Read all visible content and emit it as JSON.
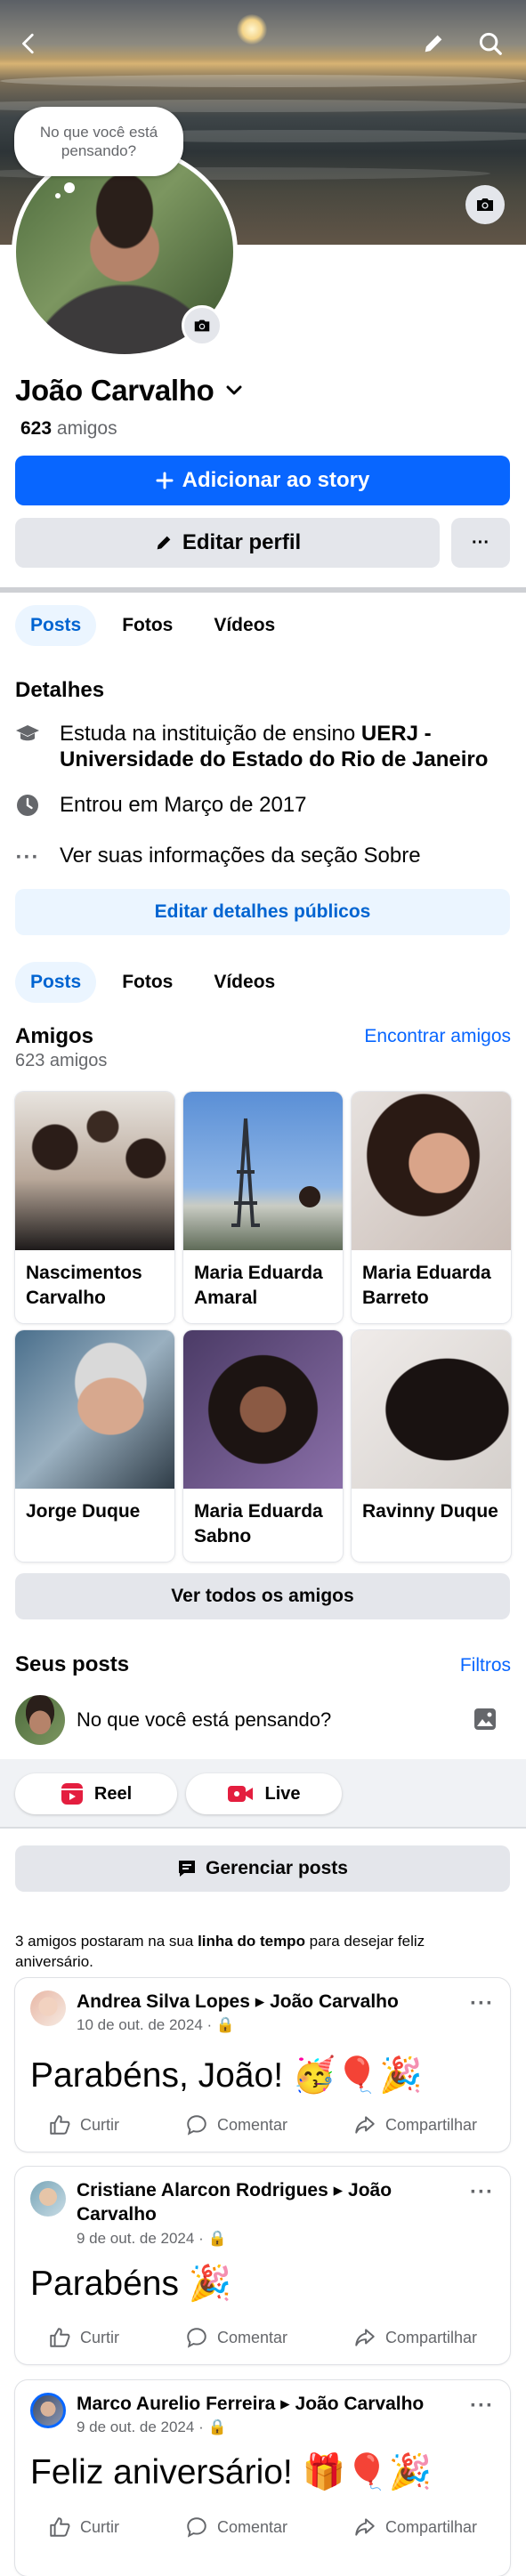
{
  "profile": {
    "bubble_text": "No que você está pensando?",
    "name": "João Carvalho",
    "friends_count": "623",
    "friends_label": "amigos"
  },
  "actions": {
    "add_story": "Adicionar ao story",
    "edit_profile": "Editar perfil",
    "more": "···"
  },
  "tabs": [
    "Posts",
    "Fotos",
    "Vídeos"
  ],
  "details": {
    "title": "Detalhes",
    "education_prefix": "Estuda na instituição de ensino ",
    "education_school": "UERJ - Universidade do Estado do Rio de Janeiro",
    "joined": "Entrou em Março de 2017",
    "about": "Ver suas informações da seção Sobre",
    "edit_public": "Editar detalhes públicos"
  },
  "friends_section": {
    "title": "Amigos",
    "count": "623 amigos",
    "find": "Encontrar amigos",
    "see_all": "Ver todos os amigos",
    "friends": [
      {
        "name": "Nascimentos Carvalho"
      },
      {
        "name": "Maria Eduarda Amaral"
      },
      {
        "name": "Maria Eduarda Barreto"
      },
      {
        "name": "Jorge Duque"
      },
      {
        "name": "Maria Eduarda Sabno"
      },
      {
        "name": "Ravinny Duque"
      }
    ]
  },
  "posts_section": {
    "title": "Seus posts",
    "filters": "Filtros",
    "composer_placeholder": "No que você está pensando?",
    "reel": "Reel",
    "live": "Live",
    "manage": "Gerenciar posts",
    "timeline_prefix": "3 amigos postaram na sua ",
    "timeline_bold": "linha do tempo",
    "timeline_suffix": " para desejar feliz aniversário."
  },
  "posts": [
    {
      "author": "Andrea Silva Lopes",
      "target": "João Carvalho",
      "date": "10 de out. de 2024 ·",
      "text": "Parabéns, João! 🥳🎈🎉"
    },
    {
      "author": "Cristiane Alarcon Rodrigues",
      "target": "João Carvalho",
      "date": "9 de out. de 2024 ·",
      "text": "Parabéns 🎉"
    },
    {
      "author": "Marco Aurelio Ferreira",
      "target": "João Carvalho",
      "date": "9 de out. de 2024 ·",
      "text": "Feliz aniversário! 🎁🎈🎉"
    }
  ],
  "post_actions": {
    "like": "Curtir",
    "comment": "Comentar",
    "share": "Compartilhar"
  },
  "colors": {
    "primary": "#0866ff",
    "secondary_bg": "#e4e6eb",
    "tab_active_bg": "#ebf5ff",
    "tab_active_text": "#0064d1"
  }
}
